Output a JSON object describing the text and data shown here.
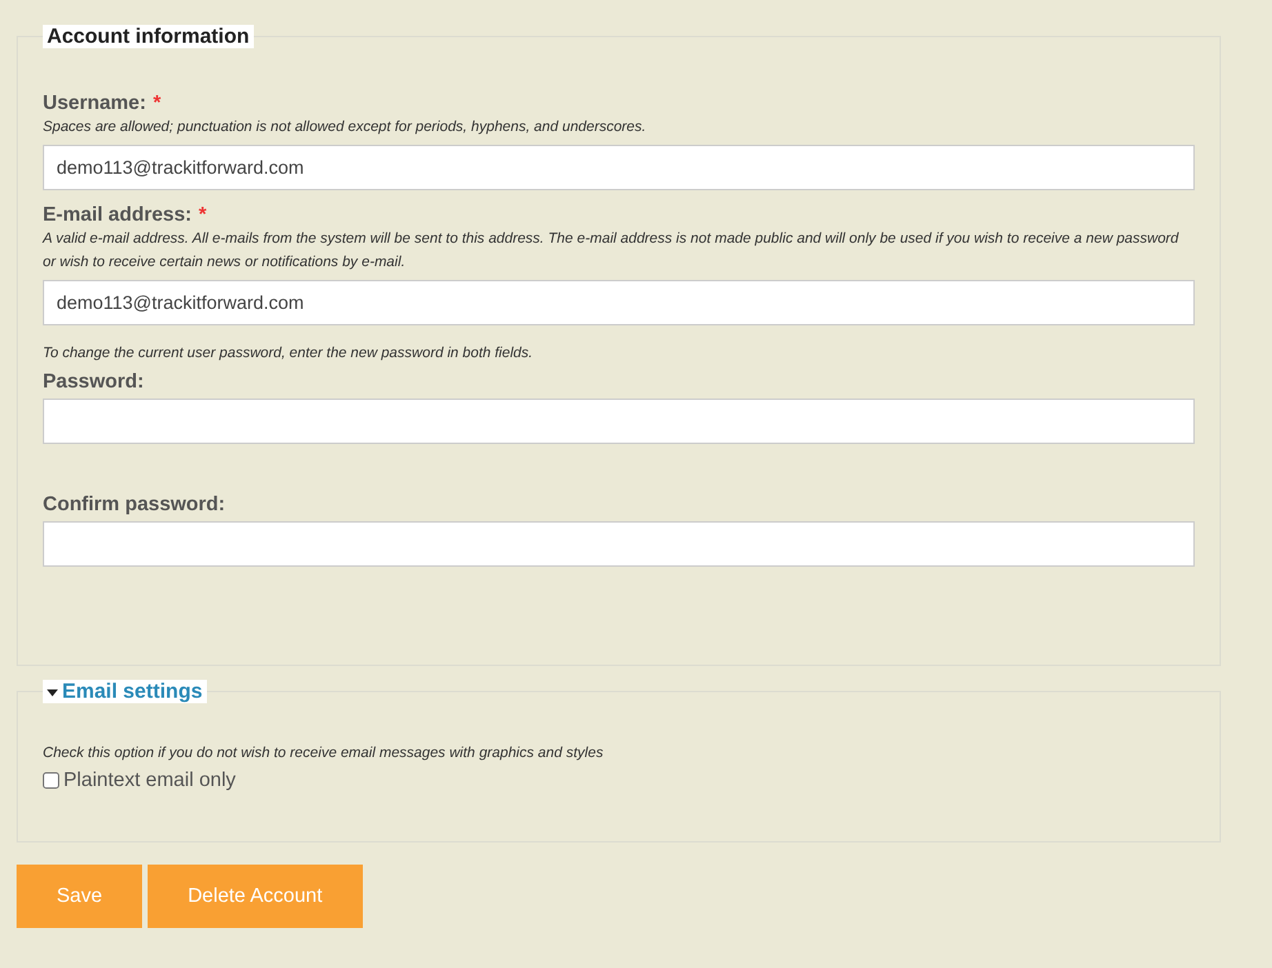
{
  "account": {
    "legend": "Account information",
    "fields": [
      {
        "label": "Username:",
        "required": true,
        "required_mark": "*",
        "description": "Spaces are allowed; punctuation is not allowed except for periods, hyphens, and underscores.",
        "value": "demo113@trackitforward.com"
      },
      {
        "label": "E-mail address:",
        "required": true,
        "required_mark": "*",
        "description": "A valid e-mail address. All e-mails from the system will be sent to this address. The e-mail address is not made public and will only be used if you wish to receive a new password or wish to receive certain news or notifications by e-mail.",
        "value": "demo113@trackitforward.com"
      },
      {
        "note": "To change the current user password, enter the new password in both fields.",
        "label": "Password:"
      },
      {
        "label": "Confirm password:"
      }
    ]
  },
  "email_settings": {
    "legend": "Email settings",
    "expanded": true,
    "description": "Check this option if you do not wish to receive email messages with graphics and styles",
    "checkbox": {
      "label": "Plaintext email only",
      "checked": false
    }
  },
  "buttons": [
    "Save",
    "Delete Account"
  ]
}
